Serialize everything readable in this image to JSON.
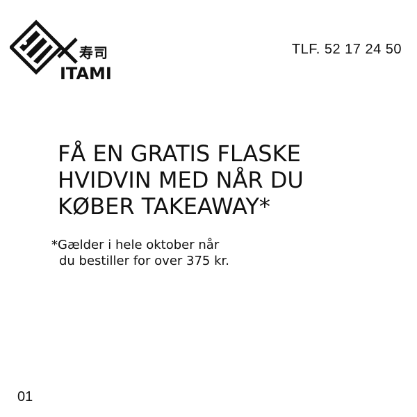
{
  "brand": {
    "kanji": "寿司",
    "wordmark": "ITAMI",
    "logo_icon": "fish-logo-icon"
  },
  "contact": {
    "phone": "TLF. 52 17 24 50"
  },
  "headline": {
    "lines": [
      "FÅ EN GRATIS FLASKE",
      "HVIDVIN MED NÅR DU",
      "KØBER TAKEAWAY*"
    ]
  },
  "footnote": {
    "lines": [
      "*Gælder i hele oktober når",
      "du bestiller for over 375 kr."
    ]
  },
  "page": {
    "number": "01"
  },
  "colors": {
    "background": "#ffffff",
    "text": "#111111"
  }
}
